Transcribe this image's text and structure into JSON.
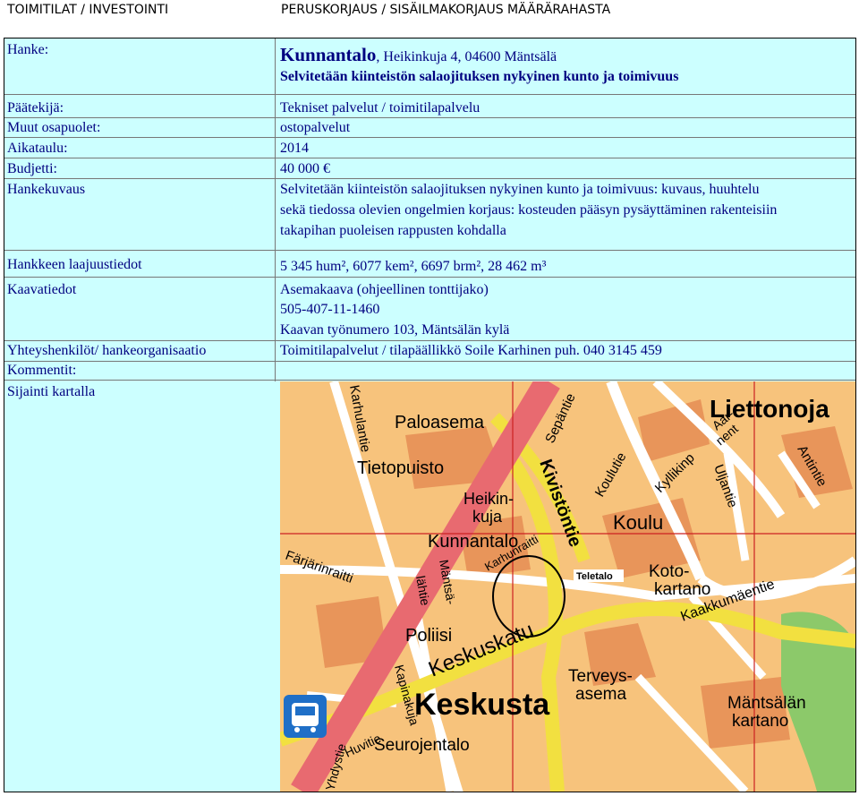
{
  "header": {
    "left": "TOIMITILAT / INVESTOINTI",
    "right": "PERUSKORJAUS / SISÄILMAKORJAUS MÄÄRÄRAHASTA"
  },
  "hanke": {
    "label": "Hanke:",
    "name": "Kunnantalo",
    "address": ", Heikinkuja 4, 04600 Mäntsälä",
    "subtitle": "Selvitetään kiinteistön salaojituksen nykyinen kunto ja toimivuus"
  },
  "fields": {
    "paatekija_label": "Päätekijä:",
    "paatekija_value": "Tekniset palvelut / toimitilapalvelu",
    "muut_label": "Muut osapuolet:",
    "muut_value": "ostopalvelut",
    "aikataulu_label": "Aikataulu:",
    "aikataulu_value": "2014",
    "budjetti_label": "Budjetti:",
    "budjetti_value": "40 000 €",
    "hankekuvaus_label": "Hankekuvaus",
    "hankekuvaus_line1": "Selvitetään kiinteistön salaojituksen nykyinen kunto ja toimivuus: kuvaus, huuhtelu",
    "hankekuvaus_line2": "sekä tiedossa olevien ongelmien korjaus: kosteuden pääsyn pysäyttäminen rakenteisiin",
    "hankekuvaus_line3": "takapihan puoleisen rappusten kohdalla",
    "laajuus_label": "Hankkeen laajuustiedot",
    "laajuus_value": "5 345 hum², 6077 kem², 6697 brm², 28 462 m³",
    "kaava_label": "Kaavatiedot",
    "kaava_line1": "Asemakaava (ohjeellinen tonttijako)",
    "kaava_line2": "505-407-11-1460",
    "kaava_line3": "Kaavan työnumero 103, Mäntsälän kylä",
    "yhteys_label": "Yhteyshenkilöt/ hankeorganisaatio",
    "yhteys_value": "Toimitilapalvelut / tilapäällikkö Soile Karhinen puh. 040 3145 459",
    "kommentit_label": "Kommentit:",
    "sijainti_label": "Sijainti kartalla"
  },
  "map": {
    "labels": {
      "liettonoja": "Liettonoja",
      "paloasema": "Paloasema",
      "tietopuisto": "Tietopuisto",
      "heikinkuja_a": "Heikin-",
      "heikinkuja_b": "kuja",
      "kunnantalo": "Kunnantalo",
      "kivistontie": "Kivistöntie",
      "koulu": "Koulu",
      "kotikartano_a": "Koto-",
      "kotikartano_b": "kartano",
      "teletalo": "Teletalo",
      "poliisi": "Poliisi",
      "keskuskatu": "Keskuskatu",
      "keskusta": "Keskusta",
      "terveysasema_a": "Terveys-",
      "terveysasema_b": "asema",
      "mantsalan_kartano_a": "Mäntsälän",
      "mantsalan_kartano_b": "kartano",
      "seurojentalo": "Seurojentalo",
      "kaakkumaentie": "Kaakkumäentie",
      "farjarinraitti": "Färjärinraitti",
      "sepantie": "Sepäntie",
      "koulutie": "Koulutie",
      "kyllikinp": "Kyllikinp",
      "uljantie": "Uljantie",
      "antintie": "Antintie",
      "karhulantie": "Karhulantie",
      "mantsalantie": "Mäntsä-",
      "huvitie": "Huvitie",
      "ydystie": "Yhdystie",
      "kapinakuja": "Kapinakuja",
      "aarnent_a": "Aar-",
      "aarnent_b": "nent",
      "karhunraitti": "Karhunraitti",
      "lahtie": "lähtie"
    },
    "colors": {
      "land": "#f7c37c",
      "block_orange": "#e8955a",
      "road": "#ffffff",
      "main_road": "#f2e040",
      "railway": "#e86a70",
      "green": "#8cc96a",
      "grid": "#cc2222"
    },
    "bus_icon": "bus-stop-icon"
  }
}
